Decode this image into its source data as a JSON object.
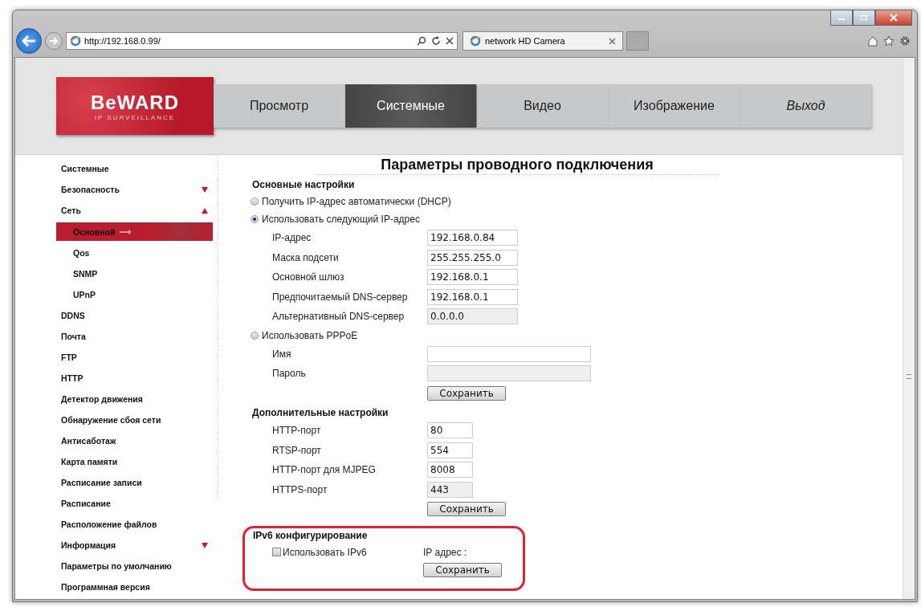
{
  "browser": {
    "address": "http://192.168.0.99/",
    "tab_title": "network HD Camera"
  },
  "logo": {
    "name": "BeWARD",
    "tagline": "IP SURVEILLANCE"
  },
  "nav": [
    {
      "label": "Просмотр",
      "selected": false,
      "kind": "page"
    },
    {
      "label": "Системные",
      "selected": true,
      "kind": "page"
    },
    {
      "label": "Видео",
      "selected": false,
      "kind": "page"
    },
    {
      "label": "Изображение",
      "selected": false,
      "kind": "page"
    },
    {
      "label": "Выход",
      "selected": false,
      "kind": "exit"
    }
  ],
  "sidebar": [
    {
      "label": "Системные",
      "kind": "item",
      "selected": false
    },
    {
      "label": "Безопасность",
      "kind": "group",
      "expanded": false,
      "selected": false
    },
    {
      "label": "Сеть",
      "kind": "group",
      "expanded": true,
      "selected": false,
      "children": [
        {
          "label": "Основной",
          "selected": true
        },
        {
          "label": "Qos",
          "selected": false
        },
        {
          "label": "SNMP",
          "selected": false
        },
        {
          "label": "UPnP",
          "selected": false
        }
      ]
    },
    {
      "label": "DDNS",
      "kind": "item",
      "selected": false
    },
    {
      "label": "Почта",
      "kind": "item",
      "selected": false
    },
    {
      "label": "FTP",
      "kind": "item",
      "selected": false
    },
    {
      "label": "HTTP",
      "kind": "item",
      "selected": false
    },
    {
      "label": "Детектор движения",
      "kind": "item",
      "selected": false
    },
    {
      "label": "Обнаружение сбоя сети",
      "kind": "item",
      "selected": false
    },
    {
      "label": "Антисаботаж",
      "kind": "item",
      "selected": false
    },
    {
      "label": "Карта памяти",
      "kind": "item",
      "selected": false
    },
    {
      "label": "Расписание записи",
      "kind": "item",
      "selected": false
    },
    {
      "label": "Расписание",
      "kind": "item",
      "selected": false
    },
    {
      "label": "Расположение файлов",
      "kind": "item",
      "selected": false
    },
    {
      "label": "Информация",
      "kind": "group",
      "expanded": false,
      "selected": false
    },
    {
      "label": "Параметры по умолчанию",
      "kind": "item",
      "selected": false
    },
    {
      "label": "Программная версия",
      "kind": "item",
      "selected": false
    }
  ],
  "page_title": "Параметры проводного подключения",
  "basic": {
    "heading": "Основные настройки",
    "options": [
      {
        "label": "Получить IP-адрес автоматически (DHCP)",
        "selected": false
      },
      {
        "label": "Использовать следующий IP-адрес",
        "selected": true,
        "fields": [
          {
            "label": "IP-адрес",
            "value": "192.168.0.84",
            "disabled": false
          },
          {
            "label": "Маска подсети",
            "value": "255.255.255.0",
            "disabled": false
          },
          {
            "label": "Основной шлюз",
            "value": "192.168.0.1",
            "disabled": false
          },
          {
            "label": "Предпочитаемый DNS-сервер",
            "value": "192.168.0.1",
            "disabled": false
          },
          {
            "label": "Альтернативный DNS-сервер",
            "value": "0.0.0.0",
            "disabled": true
          }
        ]
      },
      {
        "label": "Использовать PPPoE",
        "selected": false,
        "wide": true,
        "fields": [
          {
            "label": "Имя",
            "disabled": false
          },
          {
            "label": "Пароль",
            "disabled": true
          }
        ]
      }
    ],
    "save": "Сохранить"
  },
  "advanced": {
    "heading": "Дополнительные настройки",
    "fields": [
      {
        "label": "HTTP-порт",
        "value": "80",
        "disabled": false
      },
      {
        "label": "RTSP-порт",
        "value": "554",
        "disabled": false
      },
      {
        "label": "HTTP-порт для MJPEG",
        "value": "8008",
        "disabled": false
      },
      {
        "label": "HTTPS-порт",
        "value": "443",
        "disabled": true
      }
    ],
    "save": "Сохранить"
  },
  "ipv6": {
    "heading": "IPv6 конфигурирование",
    "checkbox": {
      "label": "Использовать IPv6",
      "checked": false
    },
    "address_label": "IP адрес :",
    "save": "Сохранить"
  }
}
